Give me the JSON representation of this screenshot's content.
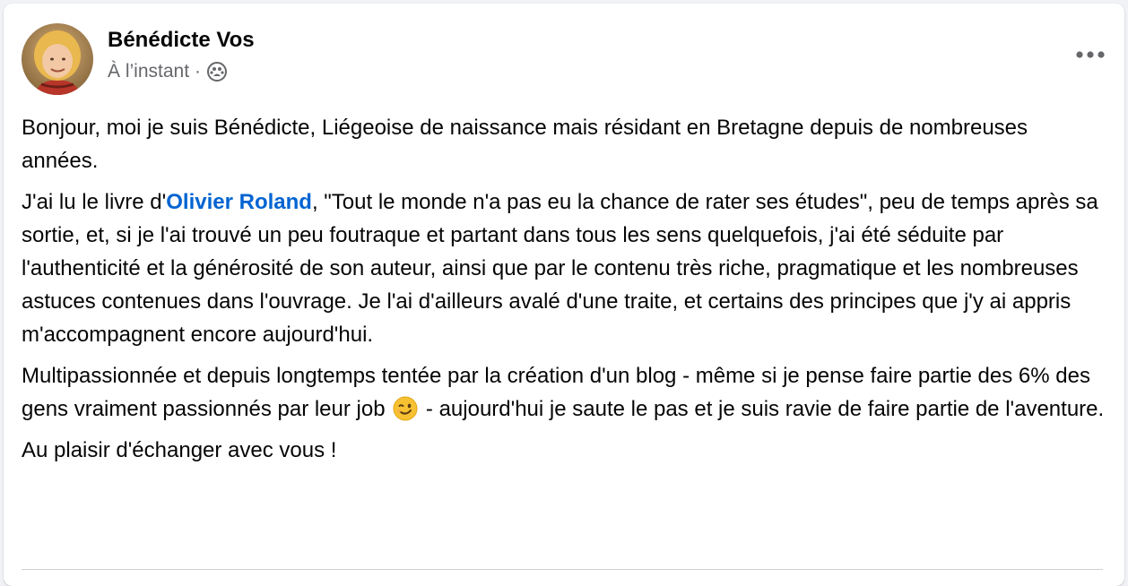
{
  "post": {
    "author": "Bénédicte Vos",
    "timestamp": "À l’instant",
    "separator": "·",
    "audience_icon": "friends-icon",
    "more_icon": "more-horizontal-icon",
    "paragraphs": {
      "p1": "Bonjour, moi je suis Bénédicte, Liégeoise de naissance mais résidant en Bretagne depuis de nombreuses années.",
      "p2_before": "J'ai lu le livre d'",
      "p2_mention": "Olivier Roland",
      "p2_after": ", \"Tout le monde n'a pas eu la chance de rater ses études\", peu de temps après sa sortie, et, si je l'ai trouvé un peu foutraque et partant dans tous les sens quelquefois, j'ai été séduite par l'authenticité et la générosité de son auteur, ainsi que par le contenu très riche, pragmatique et les nombreuses astuces contenues dans l'ouvrage. Je l'ai d'ailleurs avalé d'une traite, et certains des principes que j'y ai appris m'accompagnent encore aujourd'hui.",
      "p3_before": "Multipassionnée et depuis longtemps tentée par la création d'un blog - même si je pense faire partie des 6% des gens vraiment passionnés par leur job ",
      "p3_emoji": "winking-face-emoji",
      "p3_after": " - aujourd'hui je saute le pas et je suis ravie de faire partie de l'aventure.",
      "p4": "Au plaisir d'échanger avec vous !"
    }
  },
  "colors": {
    "text": "#050505",
    "secondary": "#65676b",
    "link": "#0064d1",
    "background": "#ffffff"
  }
}
